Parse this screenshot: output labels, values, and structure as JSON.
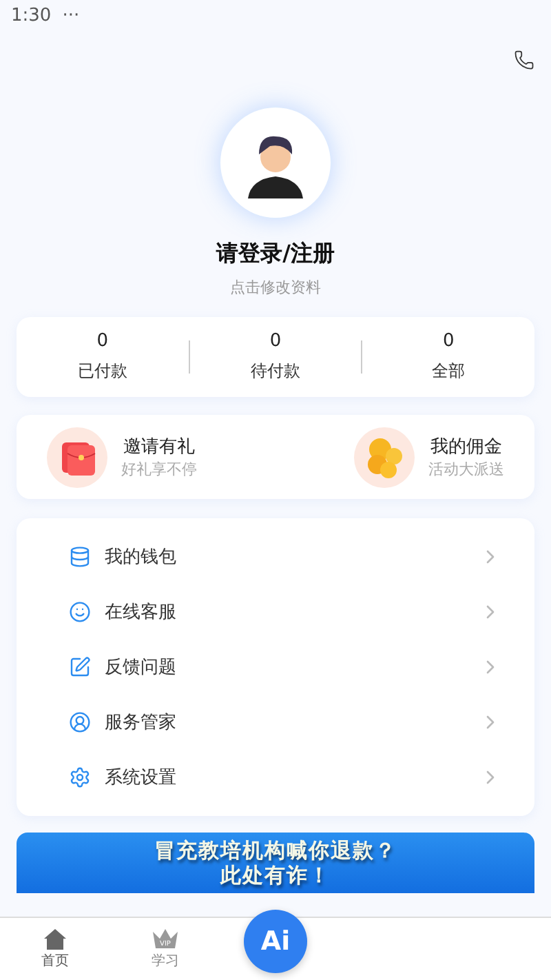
{
  "status_bar": {
    "time": "1:30",
    "dots": "···"
  },
  "profile": {
    "title": "请登录/注册",
    "subtitle": "点击修改资料"
  },
  "stats": [
    {
      "value": "0",
      "label": "已付款"
    },
    {
      "value": "0",
      "label": "待付款"
    },
    {
      "value": "0",
      "label": "全部"
    }
  ],
  "promos": [
    {
      "kind": "envelope",
      "title": "邀请有礼",
      "subtitle": "好礼享不停"
    },
    {
      "kind": "coins",
      "title": "我的佣金",
      "subtitle": "活动大派送"
    }
  ],
  "menu": [
    {
      "kind": "wallet",
      "label": "我的钱包"
    },
    {
      "kind": "smile",
      "label": "在线客服"
    },
    {
      "kind": "edit",
      "label": "反馈问题"
    },
    {
      "kind": "person",
      "label": "服务管家"
    },
    {
      "kind": "gear",
      "label": "系统设置"
    }
  ],
  "banner": {
    "lines": [
      "冒充教培机构喊你退款？",
      "此处有诈！"
    ]
  },
  "tab_bar": {
    "tabs": [
      {
        "kind": "home",
        "label": "首页",
        "selected": true
      },
      {
        "kind": "vip",
        "label": "学习",
        "badge": "VIP",
        "selected": false
      }
    ],
    "center_button": "Ai"
  }
}
